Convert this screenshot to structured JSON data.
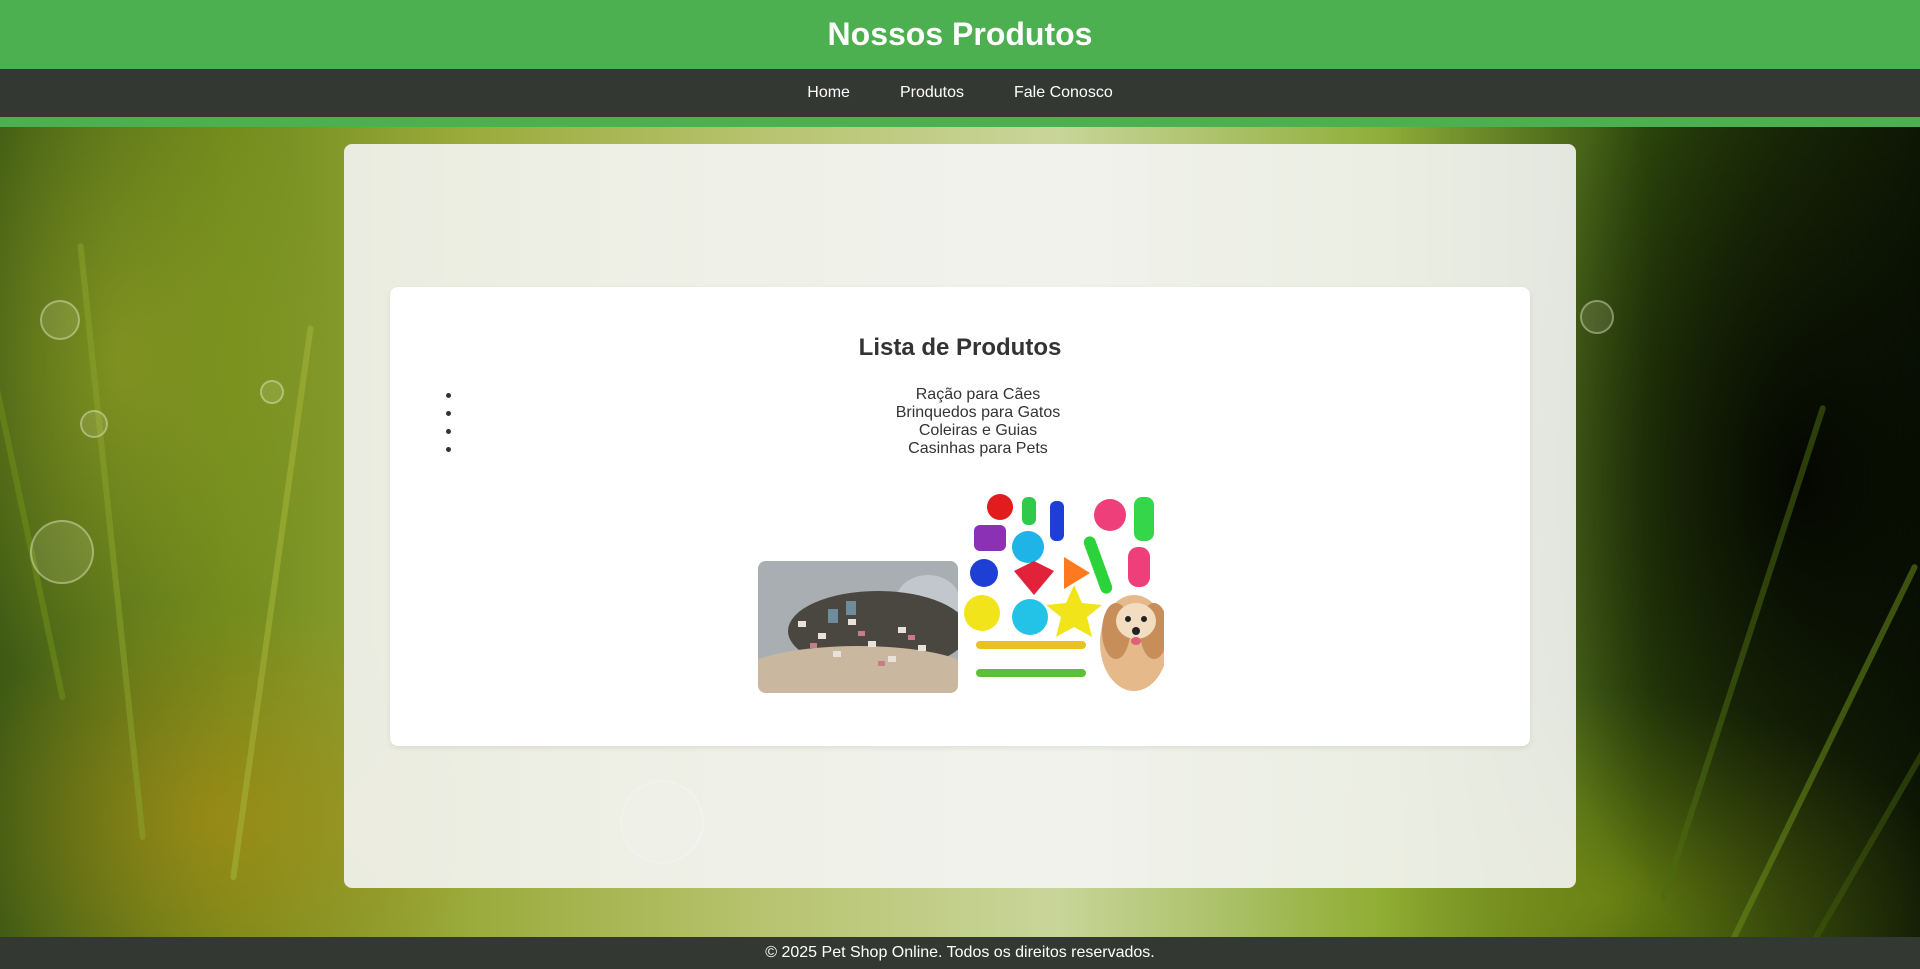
{
  "header": {
    "title": "Nossos Produtos"
  },
  "nav": {
    "items": [
      {
        "label": "Home"
      },
      {
        "label": "Produtos"
      },
      {
        "label": "Fale Conosco"
      }
    ]
  },
  "main": {
    "heading": "Lista de Produtos",
    "products": [
      "Ração para Cães",
      "Brinquedos para Gatos",
      "Coleiras e Guias",
      "Casinhas para Pets"
    ],
    "images": [
      {
        "icon": "pet-food-image"
      },
      {
        "icon": "pet-toys-dog-image"
      }
    ]
  },
  "footer": {
    "text": "© 2025 Pet Shop Online. Todos os direitos reservados."
  },
  "colors": {
    "header_green": "#4caf50",
    "nav_dark": "#333833"
  }
}
